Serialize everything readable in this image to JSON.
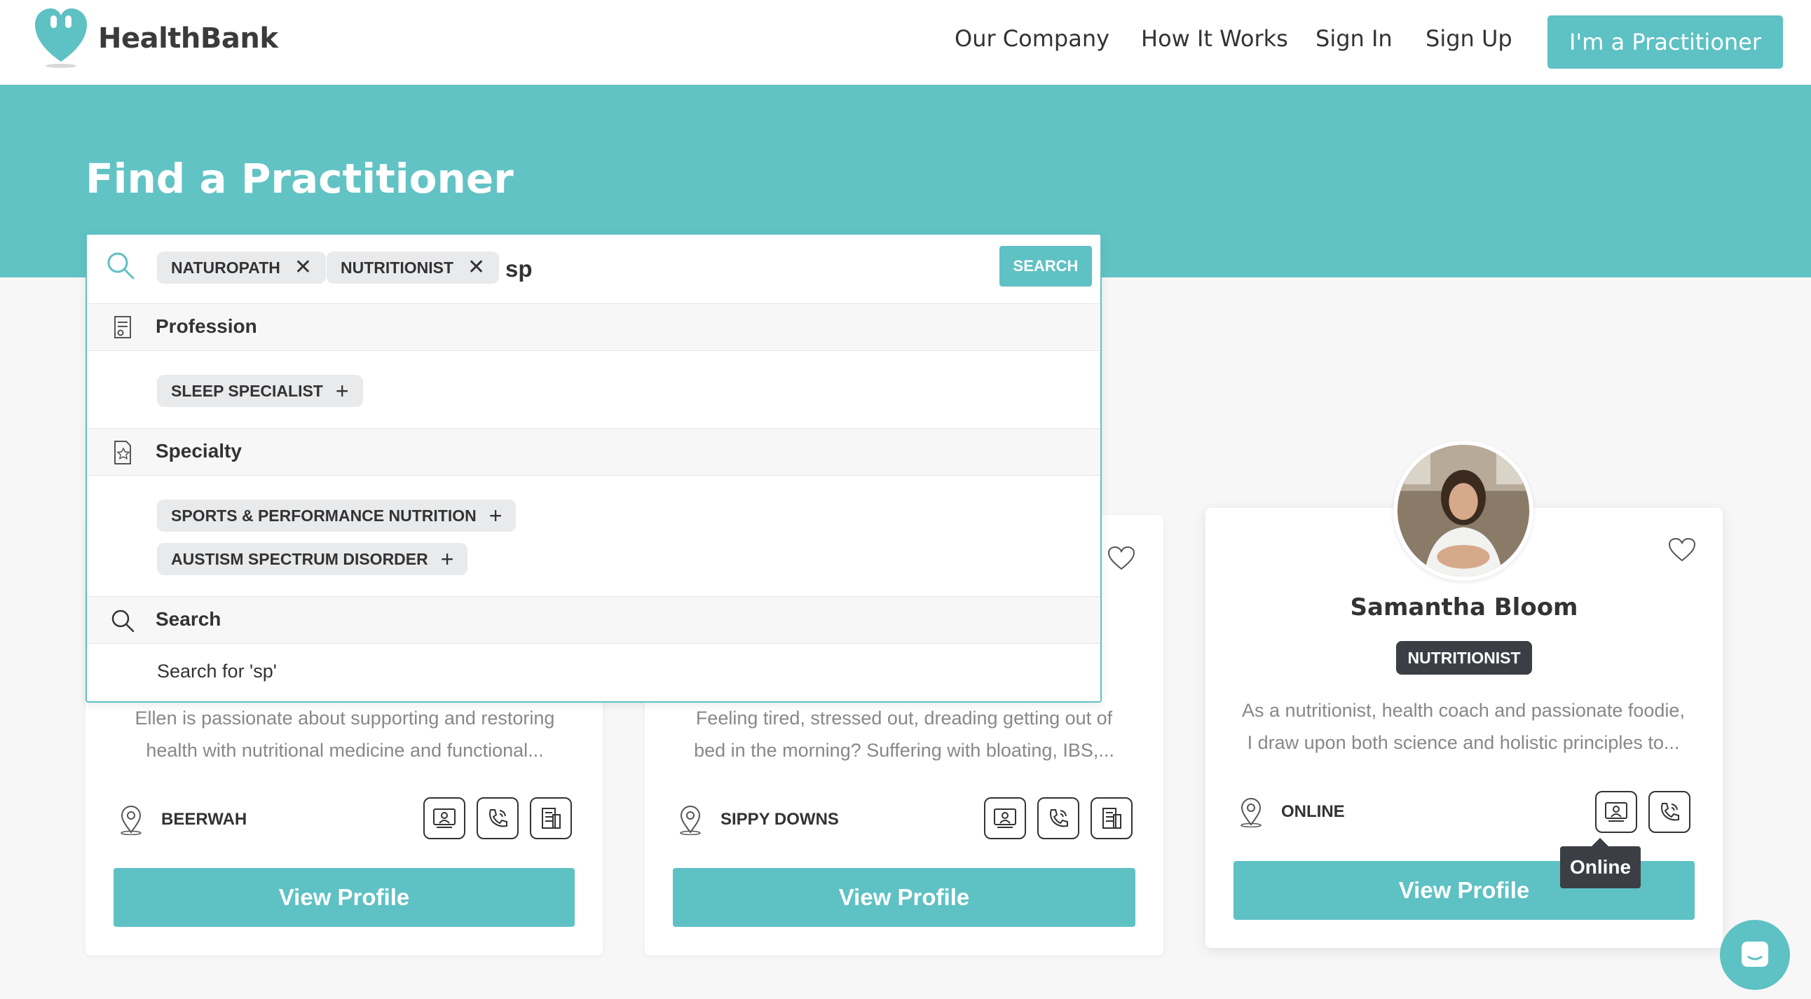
{
  "brand": {
    "name": "HealthBank",
    "accent": "#5ec1c4",
    "hero_bg": "#62c3c4",
    "badge_bg": "#3b3f45"
  },
  "nav": {
    "items": [
      "Our Company",
      "How It Works",
      "Sign In",
      "Sign Up"
    ],
    "cta": "I'm a Practitioner"
  },
  "hero": {
    "title": "Find a Practitioner"
  },
  "search": {
    "chips": [
      "NATUROPATH",
      "NUTRITIONIST"
    ],
    "typed": "sp",
    "button": "SEARCH",
    "sections": {
      "profession": {
        "label": "Profession",
        "icon": "certificate-icon",
        "options": [
          "SLEEP SPECIALIST"
        ]
      },
      "specialty": {
        "label": "Specialty",
        "icon": "document-star-icon",
        "options": [
          "SPORTS & PERFORMANCE NUTRITION",
          "AUSTISM SPECTRUM DISORDER"
        ]
      },
      "search": {
        "label": "Search",
        "icon": "search-icon",
        "option": "Search for 'sp'"
      }
    }
  },
  "cards": [
    {
      "description": [
        "Ellen is passionate about supporting and restoring",
        "health with nutritional medicine and functional..."
      ],
      "location": "BEERWAH",
      "modes": [
        "in-person-icon",
        "phone-icon",
        "clinic-icon"
      ],
      "button": "View Profile"
    },
    {
      "description": [
        "Feeling tired, stressed out, dreading getting out of",
        "bed in the morning? Suffering with bloating, IBS,..."
      ],
      "location": "SIPPY DOWNS",
      "modes": [
        "in-person-icon",
        "phone-icon",
        "clinic-icon"
      ],
      "button": "View Profile"
    },
    {
      "name": "Samantha Bloom",
      "badge": "NUTRITIONIST",
      "description": [
        "As a nutritionist, health coach and passionate foodie,",
        "I draw upon both science and holistic principles to..."
      ],
      "location": "ONLINE",
      "modes": [
        "online-icon",
        "phone-icon"
      ],
      "tooltip": "Online",
      "button": "View Profile"
    }
  ]
}
